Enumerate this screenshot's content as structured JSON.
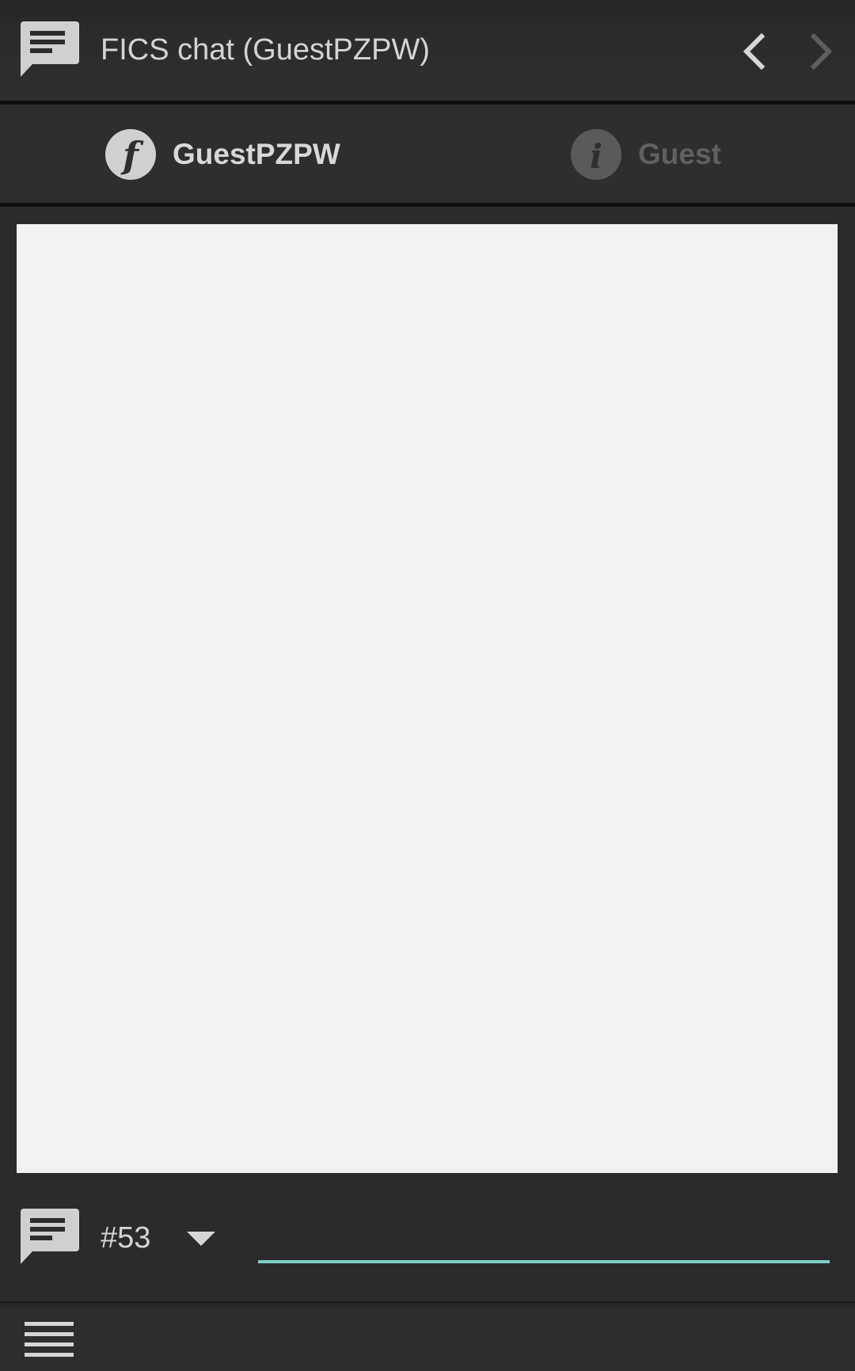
{
  "toolbar": {
    "app_icon": "chat-bubble-icon",
    "title": "FICS chat (GuestPZPW)",
    "prev_icon": "chevron-left-icon",
    "next_icon": "chevron-right-icon"
  },
  "tabs": [
    {
      "icon": "fics-logo-icon",
      "label": "GuestPZPW",
      "active": true
    },
    {
      "icon": "info-icon",
      "label": "Guest",
      "active": false
    }
  ],
  "input_bar": {
    "icon": "chat-bubble-icon",
    "channel_value": "#53",
    "dropdown_icon": "triangle-down-icon",
    "message_value": "",
    "message_placeholder": ""
  },
  "bottom_bar": {
    "menu_icon": "hamburger-menu-icon"
  },
  "colors": {
    "background": "#2b2b2d",
    "chat_area": "#f2f1f4",
    "accent": "#7ccfc9",
    "text": "#d4d4d6",
    "inactive_text": "#606062"
  }
}
